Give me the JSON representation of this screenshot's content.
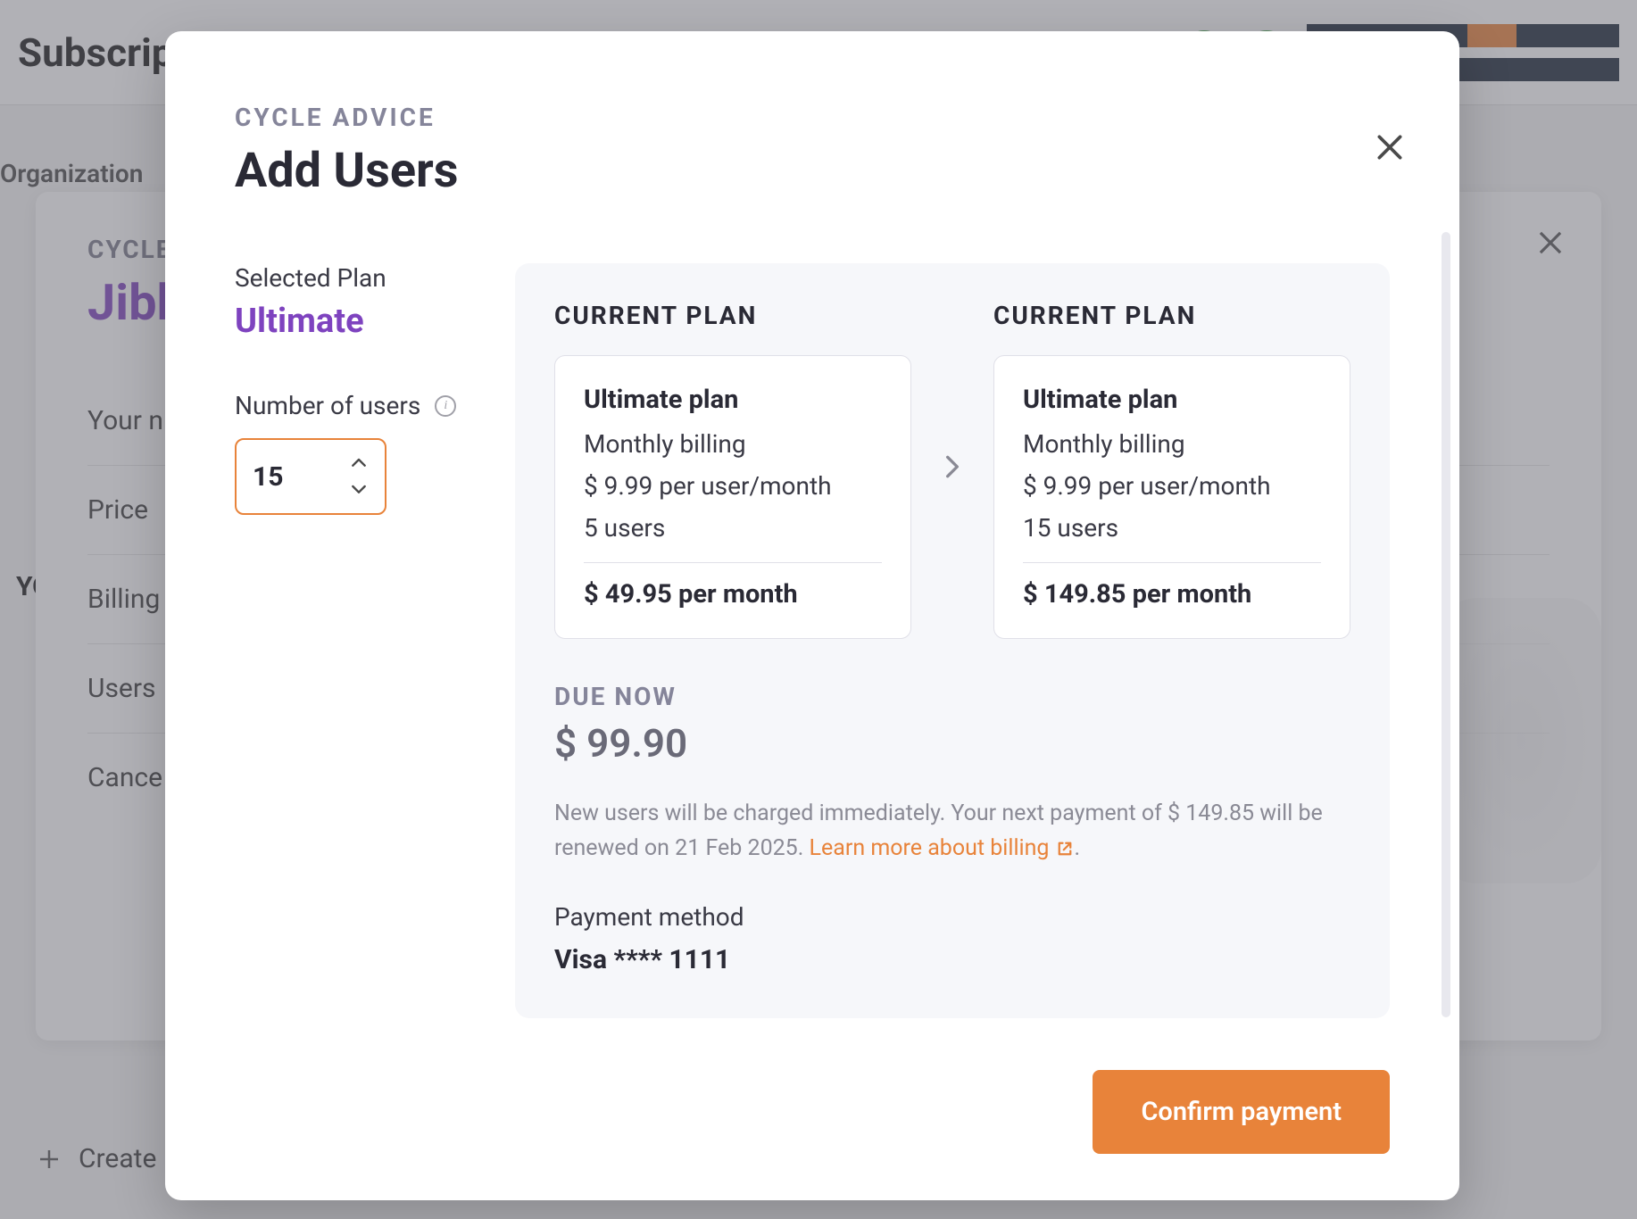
{
  "background": {
    "page_title": "Subscript",
    "org_label": "Organization",
    "card_overline": "CYCLE",
    "brand": "Jibb",
    "your_row": "Your n",
    "price_row": "Price",
    "billing_row": "Billing",
    "users_row": "Users",
    "cancel_row": "Cance",
    "heading": "YO",
    "create_label": "Create"
  },
  "modal": {
    "overline": "CYCLE ADVICE",
    "title": "Add Users",
    "left": {
      "selected_label": "Selected Plan",
      "plan_name": "Ultimate",
      "users_label": "Number of users",
      "users_value": "15"
    },
    "current_plan": {
      "header": "CURRENT PLAN",
      "title": "Ultimate plan",
      "billing": "Monthly billing",
      "rate": "$ 9.99 per user/month",
      "users": "5 users",
      "total": "$ 49.95 per month"
    },
    "new_plan": {
      "header": "CURRENT PLAN",
      "title": "Ultimate plan",
      "billing": "Monthly billing",
      "rate": "$ 9.99 per user/month",
      "users": "15 users",
      "total": "$ 149.85 per month"
    },
    "due": {
      "label": "DUE NOW",
      "amount": "$ 99.90",
      "disclaimer_1": "New users will be charged immediately. Your next payment of $ 149.85 will be renewed on 21 Feb 2025. ",
      "learn_more": "Learn more about billing"
    },
    "payment": {
      "label": "Payment method",
      "value": "Visa **** 1111"
    },
    "confirm_label": "Confirm payment"
  }
}
